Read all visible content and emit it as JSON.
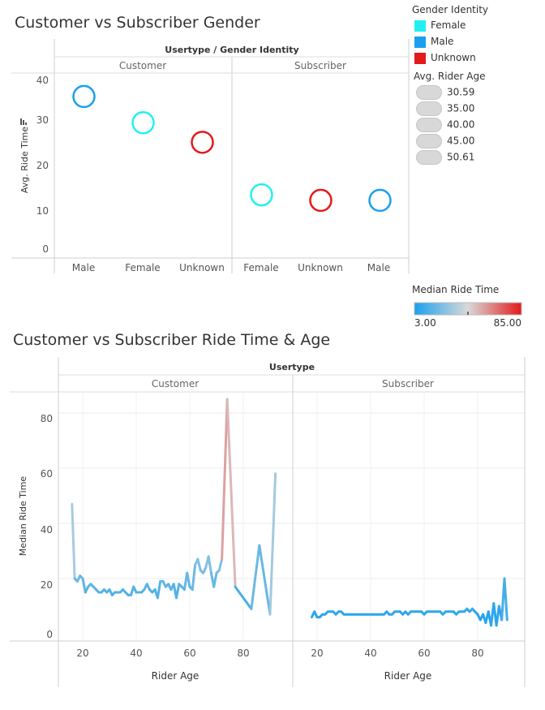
{
  "chart1": {
    "title": "Customer vs Subscriber Gender",
    "column_header": "Usertype / Gender Identity",
    "panels": [
      "Customer",
      "Subscriber"
    ],
    "ylabel": "Avg. Ride Time",
    "yticks": [
      "0",
      "10",
      "20",
      "30",
      "40"
    ]
  },
  "chart2": {
    "title": "Customer vs Subscriber Ride Time & Age",
    "column_header": "Usertype",
    "panels": [
      "Customer",
      "Subscriber"
    ],
    "ylabel": "Median Ride Time",
    "xlabel": "Rider Age",
    "yticks": [
      "0",
      "20",
      "40",
      "60",
      "80"
    ],
    "xticks": [
      "20",
      "40",
      "60",
      "80"
    ]
  },
  "legend": {
    "gender_title": "Gender Identity",
    "gender_items": [
      {
        "label": "Female",
        "color": "#22f0f0"
      },
      {
        "label": "Male",
        "color": "#1aa0ee"
      },
      {
        "label": "Unknown",
        "color": "#e31a1a"
      }
    ],
    "age_title": "Avg. Rider Age",
    "age_items": [
      "30.59",
      "35.00",
      "40.00",
      "45.00",
      "50.61"
    ],
    "median_title": "Median Ride Time",
    "median_min": "3.00",
    "median_max": "85.00"
  },
  "chart_data": [
    {
      "type": "scatter",
      "title": "Customer vs Subscriber Gender",
      "ylabel": "Avg. Ride Time",
      "ylim": [
        0,
        40
      ],
      "grid": false,
      "color_legend": "Gender Identity",
      "size_legend": "Avg. Rider Age",
      "panels": [
        {
          "name": "Customer",
          "categories": [
            "Male",
            "Female",
            "Unknown"
          ],
          "points": [
            {
              "category": "Male",
              "gender": "Male",
              "value": 36.0
            },
            {
              "category": "Female",
              "gender": "Female",
              "value": 29.8
            },
            {
              "category": "Unknown",
              "gender": "Unknown",
              "value": 25.2
            }
          ]
        },
        {
          "name": "Subscriber",
          "categories": [
            "Female",
            "Unknown",
            "Male"
          ],
          "points": [
            {
              "category": "Female",
              "gender": "Female",
              "value": 12.8
            },
            {
              "category": "Unknown",
              "gender": "Unknown",
              "value": 11.5
            },
            {
              "category": "Male",
              "gender": "Male",
              "value": 11.5
            }
          ]
        }
      ]
    },
    {
      "type": "line",
      "title": "Customer vs Subscriber Ride Time & Age",
      "xlabel": "Rider Age",
      "ylabel": "Median Ride Time",
      "ylim": [
        0,
        90
      ],
      "xlim": [
        12,
        97
      ],
      "grid": true,
      "color_scale": {
        "name": "Median Ride Time",
        "min": 3.0,
        "max": 85.0
      },
      "series": [
        {
          "panel": "Customer",
          "x": [
            16,
            17,
            18,
            19,
            20,
            21,
            22,
            23,
            24,
            25,
            26,
            27,
            28,
            29,
            30,
            31,
            32,
            33,
            34,
            35,
            36,
            37,
            38,
            39,
            40,
            41,
            42,
            43,
            44,
            45,
            46,
            47,
            48,
            49,
            50,
            51,
            52,
            53,
            54,
            55,
            56,
            57,
            58,
            59,
            60,
            61,
            62,
            63,
            64,
            65,
            66,
            67,
            68,
            69,
            70,
            71,
            72,
            74,
            77,
            83,
            86,
            90,
            92
          ],
          "y": [
            47,
            20,
            19,
            21,
            20,
            15,
            17,
            18,
            17,
            16,
            15,
            15,
            16,
            15,
            16,
            14,
            15,
            15,
            15,
            16,
            15,
            14,
            14,
            17,
            15,
            15,
            15,
            16,
            18,
            16,
            15,
            16,
            13,
            19,
            19,
            17,
            18,
            16,
            18,
            13,
            18,
            17,
            16,
            22,
            17,
            16,
            25,
            27,
            23,
            22,
            24,
            28,
            22,
            17,
            22,
            23,
            27,
            85,
            17,
            9,
            32,
            7,
            58
          ]
        },
        {
          "panel": "Subscriber",
          "x": [
            18,
            19,
            20,
            21,
            22,
            23,
            24,
            25,
            26,
            27,
            28,
            29,
            30,
            31,
            32,
            33,
            34,
            35,
            36,
            37,
            38,
            39,
            40,
            41,
            42,
            43,
            44,
            45,
            46,
            47,
            48,
            49,
            50,
            51,
            52,
            53,
            54,
            55,
            56,
            57,
            58,
            59,
            60,
            61,
            62,
            63,
            64,
            65,
            66,
            67,
            68,
            69,
            70,
            71,
            72,
            73,
            74,
            75,
            76,
            77,
            78,
            79,
            80,
            81,
            82,
            83,
            84,
            85,
            86,
            87,
            88,
            89,
            90,
            91
          ],
          "y": [
            6,
            8,
            6,
            6,
            7,
            7,
            8,
            8,
            8,
            7,
            8,
            8,
            7,
            7,
            7,
            7,
            7,
            7,
            7,
            7,
            7,
            7,
            7,
            7,
            7,
            7,
            7,
            7,
            8,
            7,
            7,
            8,
            8,
            8,
            7,
            8,
            7,
            8,
            8,
            8,
            8,
            8,
            7,
            8,
            8,
            8,
            8,
            8,
            8,
            7,
            8,
            8,
            8,
            8,
            7,
            8,
            8,
            8,
            9,
            8,
            9,
            8,
            7,
            5,
            7,
            4,
            8,
            3,
            11,
            3,
            10,
            5,
            20,
            5
          ]
        }
      ]
    }
  ]
}
